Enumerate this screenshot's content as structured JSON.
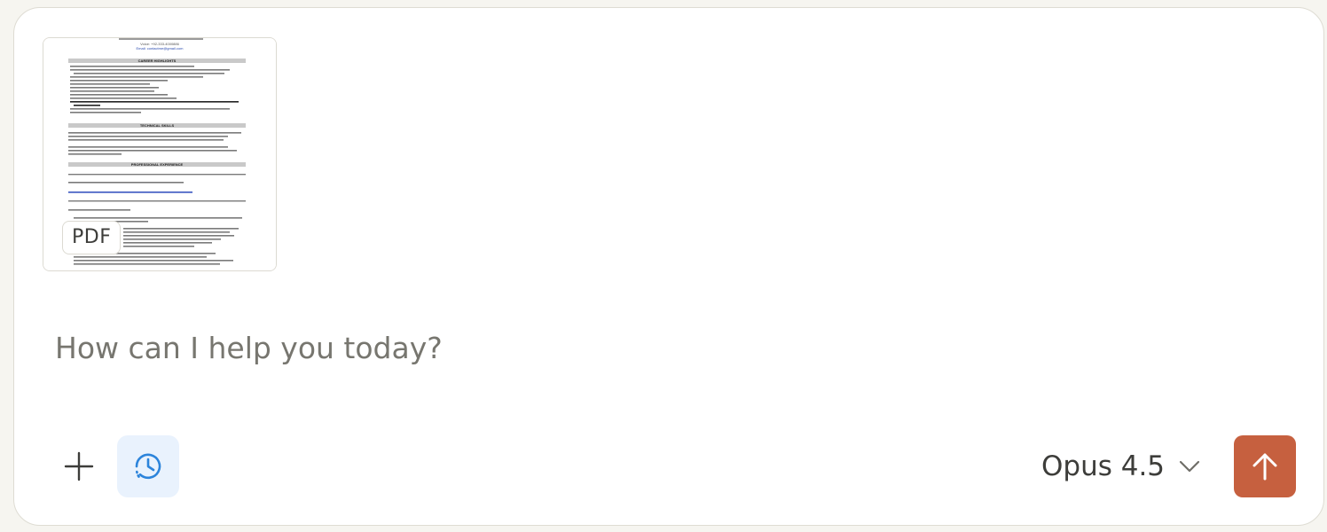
{
  "attachment": {
    "badge": "PDF",
    "thumbnail": {
      "contact_voice": "Voice: +92-333-4000886",
      "contact_email": "Email: contactme@gmail.com",
      "sections": [
        "CAREER HIGHLIGHTS",
        "TECHNICAL SKILLS",
        "PROFESSIONAL EXPERIENCE"
      ]
    }
  },
  "prompt": {
    "placeholder": "How can I help you today?",
    "value": ""
  },
  "toolbar": {
    "add_icon": "plus-icon",
    "history_icon": "history-clock-icon"
  },
  "model_selector": {
    "selected": "Opus 4.5",
    "icon": "chevron-down-icon"
  },
  "send": {
    "icon": "arrow-up-icon",
    "color": "#c6603f"
  },
  "colors": {
    "background": "#f6f5f0",
    "composer": "#ffffff",
    "history_button": "#e9f2fd",
    "history_icon": "#2c84db",
    "accent": "#c6603f"
  }
}
